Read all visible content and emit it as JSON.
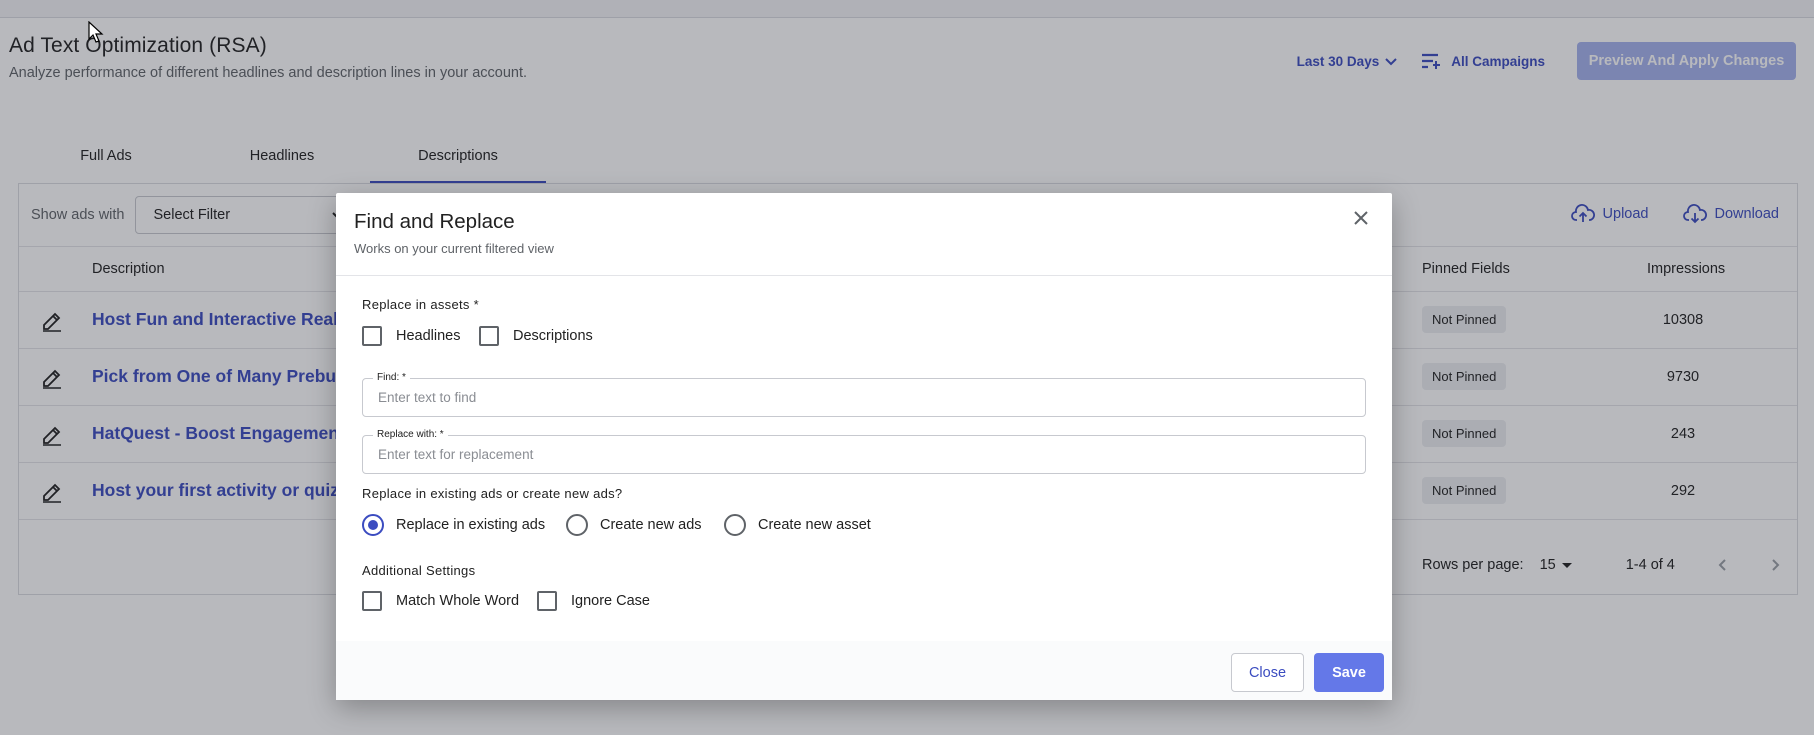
{
  "page": {
    "title": "Ad Text Optimization (RSA)",
    "subtitle": "Analyze performance of different headlines and description lines in your account."
  },
  "header_actions": {
    "date_range": "Last 30 Days",
    "campaigns": "All Campaigns",
    "preview_button": "Preview And Apply Changes"
  },
  "tabs": [
    {
      "label": "Full Ads",
      "active": false
    },
    {
      "label": "Headlines",
      "active": false
    },
    {
      "label": "Descriptions",
      "active": true
    }
  ],
  "filter": {
    "label": "Show ads with",
    "value": "Select Filter"
  },
  "card_actions": {
    "upload": "Upload",
    "download": "Download"
  },
  "table": {
    "columns": {
      "description": "Description",
      "pinned": "Pinned Fields",
      "impressions": "Impressions"
    },
    "rows": [
      {
        "description": "Host Fun and Interactive Real-T",
        "pinned": "Not Pinned",
        "impressions": "10308"
      },
      {
        "description": "Pick from One of Many Prebuil",
        "pinned": "Not Pinned",
        "impressions": "9730"
      },
      {
        "description": "HatQuest - Boost Engagement",
        "pinned": "Not Pinned",
        "impressions": "243"
      },
      {
        "description": "Host your first activity or quiz f",
        "pinned": "Not Pinned",
        "impressions": "292"
      }
    ]
  },
  "pagination": {
    "rows_per_page_label": "Rows per page:",
    "rows_per_page": "15",
    "range": "1-4 of 4"
  },
  "dialog": {
    "title": "Find and Replace",
    "subtitle": "Works on your current filtered view",
    "assets_label": "Replace in assets *",
    "assets": [
      {
        "label": "Headlines",
        "checked": false
      },
      {
        "label": "Descriptions",
        "checked": false
      }
    ],
    "find": {
      "label": "Find: *",
      "placeholder": "Enter text to find",
      "value": ""
    },
    "replace": {
      "label": "Replace with: *",
      "placeholder": "Enter text for replacement",
      "value": ""
    },
    "mode_label": "Replace in existing ads or create new ads?",
    "modes": [
      {
        "label": "Replace in existing ads",
        "checked": true
      },
      {
        "label": "Create new ads",
        "checked": false
      },
      {
        "label": "Create new asset",
        "checked": false
      }
    ],
    "settings_label": "Additional Settings",
    "settings": [
      {
        "label": "Match Whole Word",
        "checked": false
      },
      {
        "label": "Ignore Case",
        "checked": false
      }
    ],
    "close_button": "Close",
    "save_button": "Save"
  },
  "colors": {
    "accent": "#3b4cc0",
    "primary_button": "#6478e8"
  },
  "icons": [
    "chevron-down-icon",
    "filter-list-icon",
    "upload-cloud-icon",
    "download-cloud-icon",
    "edit-pencil-icon",
    "close-icon",
    "chevron-left-icon",
    "chevron-right-icon",
    "mouse-cursor-icon"
  ]
}
